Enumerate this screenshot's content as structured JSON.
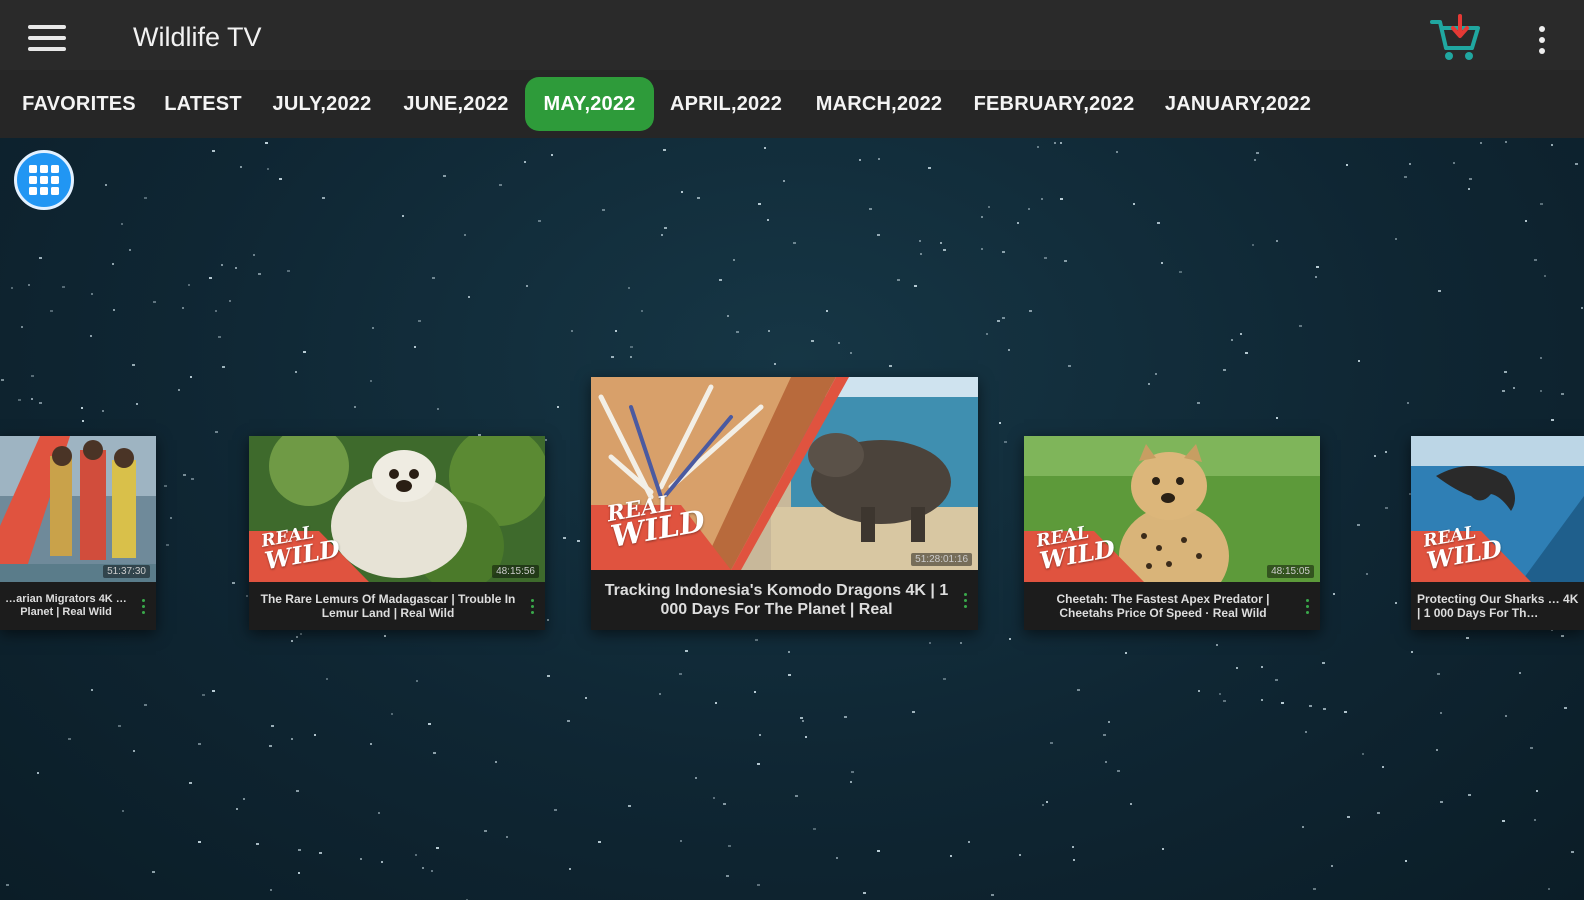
{
  "app": {
    "title": "Wildlife TV"
  },
  "tabs": [
    {
      "label": "FAVORITES"
    },
    {
      "label": "LATEST"
    },
    {
      "label": "JULY,2022"
    },
    {
      "label": "JUNE,2022"
    },
    {
      "label": "MAY,2022",
      "active": true
    },
    {
      "label": "APRIL,2022"
    },
    {
      "label": "MARCH,2022"
    },
    {
      "label": "FEBRUARY,2022"
    },
    {
      "label": "JANUARY,2022"
    }
  ],
  "colors": {
    "accent": "#2e9b3a",
    "cart": "#20a7a0",
    "cart_arrow": "#e53935",
    "fab": "#2196f3",
    "appbar": "#2a2a2a",
    "background": "#0f2430",
    "brand_red": "#e0533f"
  },
  "icons": {
    "menu": "hamburger-menu-icon",
    "cart": "cart-download-icon",
    "overflow": "more-vert-icon",
    "grid": "grid-view-icon"
  },
  "cards": [
    {
      "title": "…arian Migrators 4K …Planet | Real Wild",
      "duration": "51:37:30",
      "brand": "REAL WILD"
    },
    {
      "title": "The Rare Lemurs Of Madagascar | Trouble In Lemur Land | Real Wild",
      "duration": "48:15:56",
      "brand": "REAL WILD"
    },
    {
      "title": "Tracking Indonesia's Komodo Dragons 4K | 1 000 Days For The Planet | Real",
      "duration": "51:28:01:16",
      "brand": "REAL WILD"
    },
    {
      "title": "Cheetah: The Fastest Apex Predator | Cheetahs Price Of Speed · Real Wild",
      "duration": "48:15:05",
      "brand": "REAL WILD"
    },
    {
      "title": "Protecting Our Sharks … 4K | 1 000 Days For Th…",
      "duration": "",
      "brand": "REAL WILD"
    }
  ]
}
